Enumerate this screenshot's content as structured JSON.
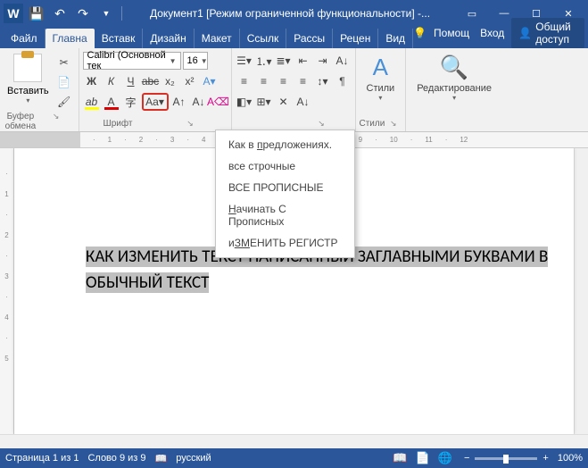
{
  "titlebar": {
    "title": "Документ1 [Режим ограниченной функциональности] -..."
  },
  "tabs": {
    "file": "Файл",
    "home": "Главна",
    "insert": "Вставк",
    "design": "Дизайн",
    "layout": "Макет",
    "references": "Ссылк",
    "mailings": "Рассы",
    "review": "Рецен",
    "view": "Вид",
    "help": "Помощ",
    "signin": "Вход",
    "share": "Общий доступ"
  },
  "ribbon": {
    "paste": "Вставить",
    "font_name": "Calibri (Основной тек",
    "font_size": "16",
    "styles": "Стили",
    "editing": "Редактирование",
    "group_clipboard": "Буфер обмена",
    "group_font": "Шрифт",
    "group_styles": "Стили"
  },
  "case_menu": {
    "item1": "Как в предложениях.",
    "item2": "все строчные",
    "item3": "ВСЕ ПРОПИСНЫЕ",
    "item4": "Начинать С Прописных",
    "item5": "иЗМЕНИТЬ РЕГИСТР"
  },
  "document": {
    "selected_text": "КАК ИЗМЕНИТЬ ТЕКСТ НАПИСАННЫЙ ЗАГЛАВНЫМИ БУКВАМИ В ОБЫЧНЫЙ ТЕКСТ"
  },
  "statusbar": {
    "page": "Страница 1 из 1",
    "words": "Слово 9 из 9",
    "lang": "русский",
    "zoom": "100%"
  }
}
